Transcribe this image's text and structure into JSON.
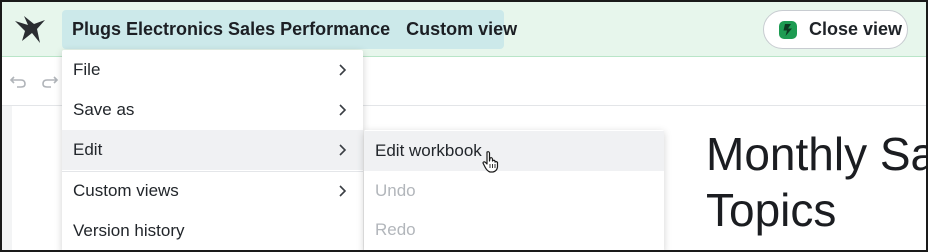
{
  "header": {
    "workbook_title": "Plugs Electronics Sales Performance",
    "view_label": "Custom view",
    "close_label": "Close view"
  },
  "file_menu": {
    "items": [
      {
        "label": "File",
        "has_submenu": true
      },
      {
        "label": "Save as",
        "has_submenu": true
      },
      {
        "label": "Edit",
        "has_submenu": true,
        "active": true
      },
      {
        "label": "Custom views",
        "has_submenu": true
      },
      {
        "label": "Version history",
        "has_submenu": false
      }
    ]
  },
  "edit_submenu": {
    "items": [
      {
        "label": "Edit workbook",
        "enabled": true,
        "hovered": true
      },
      {
        "label": "Undo",
        "enabled": false
      },
      {
        "label": "Redo",
        "enabled": false
      }
    ]
  },
  "canvas": {
    "title_line1": "Monthly Sal",
    "title_line2": "Topics"
  },
  "colors": {
    "header_bg": "#e7f6ec",
    "title_pill_bg": "#cce9ea",
    "brand_green": "#1d9b52"
  }
}
